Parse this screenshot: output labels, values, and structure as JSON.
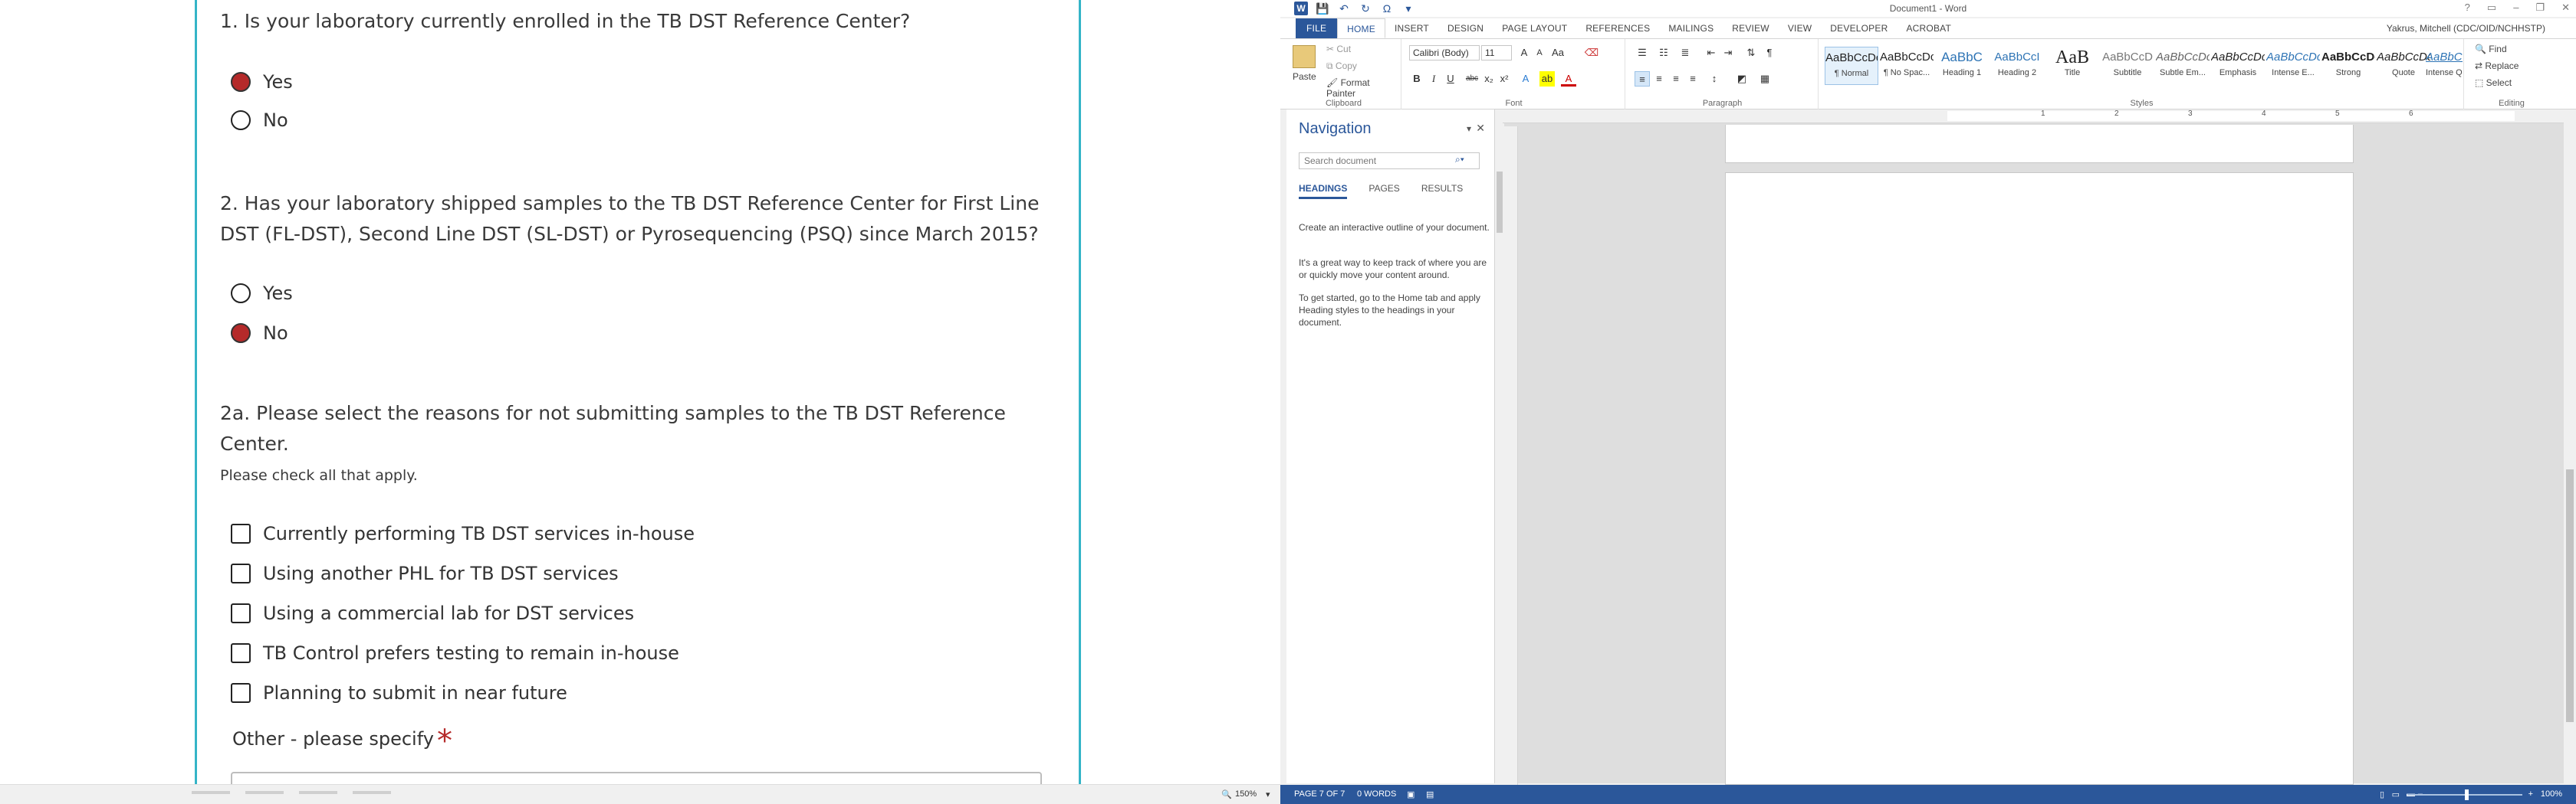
{
  "survey": {
    "q1": {
      "text": "1. Is your laboratory currently enrolled in the TB DST Reference Center?",
      "options": [
        {
          "label": "Yes",
          "selected": true
        },
        {
          "label": "No",
          "selected": false
        }
      ]
    },
    "q2": {
      "text": "2. Has your laboratory shipped samples to the TB DST Reference Center for First Line DST (FL-DST), Second Line DST (SL-DST) or Pyrosequencing (PSQ) since March 2015?",
      "options": [
        {
          "label": "Yes",
          "selected": false
        },
        {
          "label": "No",
          "selected": true
        }
      ]
    },
    "q2a": {
      "text": "2a. Please select the reasons for not submitting samples to the TB DST Reference Center.",
      "hint": "Please check all that apply.",
      "options": [
        "Currently performing TB DST services in-house",
        "Using another PHL for TB DST services",
        "Using a commercial lab for DST services",
        "TB Control prefers testing to remain in-house",
        "Planning to submit in near future"
      ],
      "other_label": "Other - please specify",
      "required_mark": "*"
    },
    "status": {
      "zoom": "150%"
    }
  },
  "word": {
    "doc_title": "Document1 - Word",
    "user": "Yakrus, Mitchell (CDC/OID/NCHHSTP)",
    "tabs": [
      "FILE",
      "HOME",
      "INSERT",
      "DESIGN",
      "PAGE LAYOUT",
      "REFERENCES",
      "MAILINGS",
      "REVIEW",
      "VIEW",
      "DEVELOPER",
      "ACROBAT"
    ],
    "active_tab": "HOME",
    "clipboard": {
      "paste": "Paste",
      "cut": "Cut",
      "copy": "Copy",
      "format_painter": "Format Painter",
      "title": "Clipboard"
    },
    "font": {
      "name": "Calibri (Body)",
      "size": "11",
      "title": "Font"
    },
    "paragraph": {
      "title": "Paragraph"
    },
    "styles": {
      "title": "Styles",
      "items": [
        {
          "preview": "AaBbCcDc",
          "name": "¶ Normal"
        },
        {
          "preview": "AaBbCcDc",
          "name": "¶ No Spac..."
        },
        {
          "preview": "AaBbC",
          "name": "Heading 1"
        },
        {
          "preview": "AaBbCcI",
          "name": "Heading 2"
        },
        {
          "preview": "AaB",
          "name": "Title"
        },
        {
          "preview": "AaBbCcD",
          "name": "Subtitle"
        },
        {
          "preview": "AaBbCcDc",
          "name": "Subtle Em..."
        },
        {
          "preview": "AaBbCcDc",
          "name": "Emphasis"
        },
        {
          "preview": "AaBbCcDc",
          "name": "Intense E..."
        },
        {
          "preview": "AaBbCcDc",
          "name": "Strong"
        },
        {
          "preview": "AaBbCcDc",
          "name": "Quote"
        },
        {
          "preview": "AaBbCcDc",
          "name": "Intense Q..."
        }
      ]
    },
    "editing": {
      "find": "Find",
      "replace": "Replace",
      "select": "Select",
      "title": "Editing"
    },
    "nav": {
      "title": "Navigation",
      "search_placeholder": "Search document",
      "tabs": [
        "HEADINGS",
        "PAGES",
        "RESULTS"
      ],
      "paragraphs": [
        "Create an interactive outline of your document.",
        "It's a great way to keep track of where you are or quickly move your content around.",
        "To get started, go to the Home tab and apply Heading styles to the headings in your document."
      ]
    },
    "ruler_numbers": [
      "1",
      "2",
      "3",
      "4",
      "5",
      "6"
    ],
    "status": {
      "page": "PAGE 7 OF 7",
      "words": "0 WORDS",
      "zoom": "100%"
    }
  }
}
